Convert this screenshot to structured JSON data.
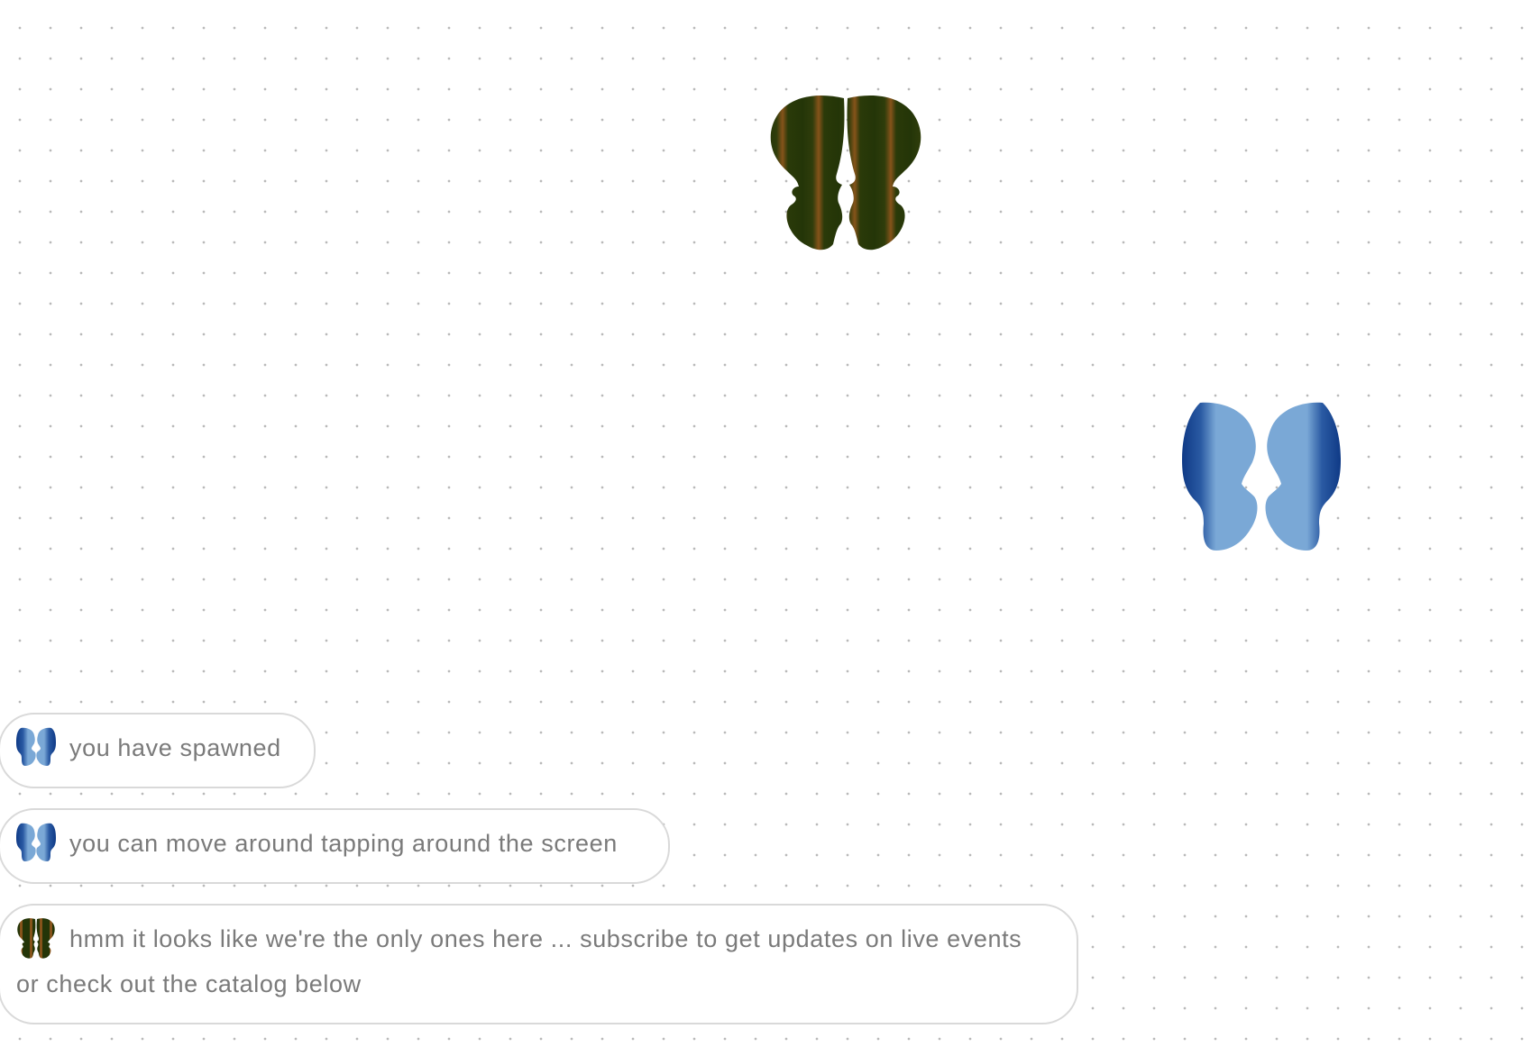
{
  "world": {
    "colors": {
      "background": "#ffffff",
      "grid_dot": "#b9b9b9",
      "bubble_border": "#d9d9d9",
      "bubble_text": "#7a7a7a"
    },
    "butterflies": [
      {
        "id": "peer",
        "icon": "striped-green-butterfly-icon",
        "palette": [
          "#243508",
          "#2e3a0a",
          "#7d4a10",
          "#8a5a16"
        ]
      },
      {
        "id": "self",
        "icon": "blue-butterfly-icon",
        "palette": [
          "#0f3a86",
          "#2a5aa3",
          "#7aa8d6",
          "#6f9fd0"
        ]
      }
    ]
  },
  "messages": [
    {
      "avatar": "blue-butterfly-icon",
      "text": "you have spawned"
    },
    {
      "avatar": "blue-butterfly-icon",
      "text": "you can move around tapping around the screen"
    },
    {
      "avatar": "striped-green-butterfly-icon",
      "text": "hmm it looks like we're the only ones here ... subscribe to get updates on live events or check out the catalog below"
    }
  ]
}
